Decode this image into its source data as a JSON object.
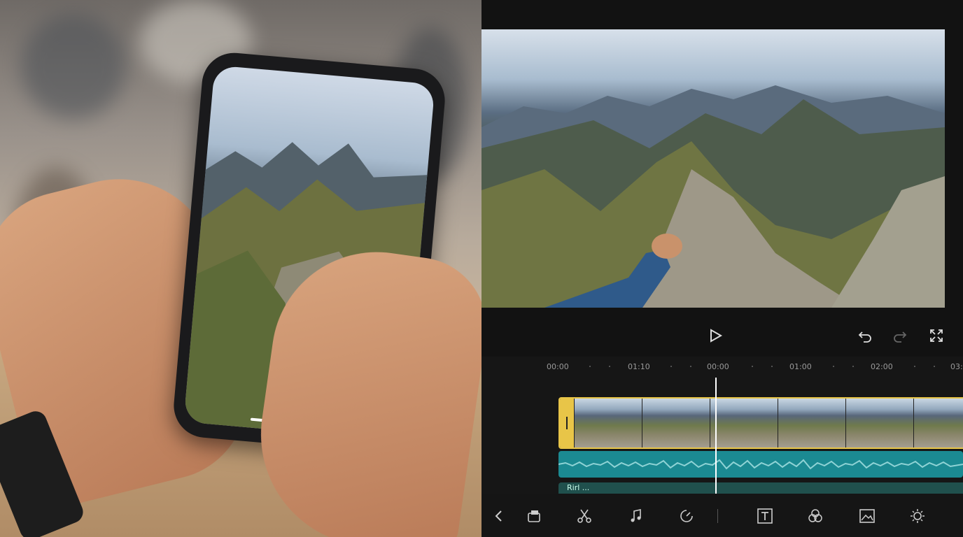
{
  "phone": {
    "label": ""
  },
  "editor": {
    "timeline": {
      "ticks": [
        "00:00",
        "01:10",
        "00:00",
        "01:00",
        "02:00",
        "03:"
      ],
      "subtitle_track_label": "Rirl ...",
      "playhead_position_label": "00:00"
    },
    "colors": {
      "accent_yellow": "#e8c548",
      "audio_teal": "#1b8a92",
      "record_red": "#e94838"
    },
    "toolbar_icons": [
      "back-chevron-icon",
      "stickers-icon",
      "scissors-icon",
      "music-note-icon",
      "speed-icon",
      "text-icon",
      "filters-icon",
      "image-icon",
      "adjust-icon"
    ],
    "controls_icons": [
      "play-icon",
      "undo-icon",
      "redo-icon",
      "fullscreen-icon"
    ]
  }
}
